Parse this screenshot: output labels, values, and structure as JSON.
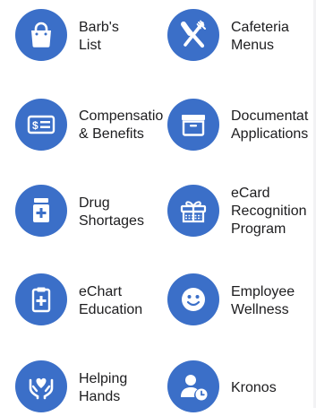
{
  "theme": {
    "icon_bg": "#3b6fc8",
    "icon_fg": "#ffffff",
    "text_color": "#1d1d1f"
  },
  "apps": [
    {
      "label": "Barb's\nList",
      "icon": "shopping-bag-icon"
    },
    {
      "label": "Cafeteria\nMenus",
      "icon": "fork-knife-icon"
    },
    {
      "label": "Compensatio\n& Benefits",
      "icon": "money-card-icon"
    },
    {
      "label": "Documentat\nApplications",
      "icon": "archive-box-icon"
    },
    {
      "label": "Drug\nShortages",
      "icon": "medicine-bottle-icon"
    },
    {
      "label": "eCard\nRecognition\nProgram",
      "icon": "gift-box-icon"
    },
    {
      "label": "eChart\nEducation",
      "icon": "medical-clipboard-icon"
    },
    {
      "label": "Employee\nWellness",
      "icon": "smiley-face-icon"
    },
    {
      "label": "Helping\nHands",
      "icon": "helping-hands-icon"
    },
    {
      "label": "Kronos",
      "icon": "user-clock-icon"
    }
  ]
}
